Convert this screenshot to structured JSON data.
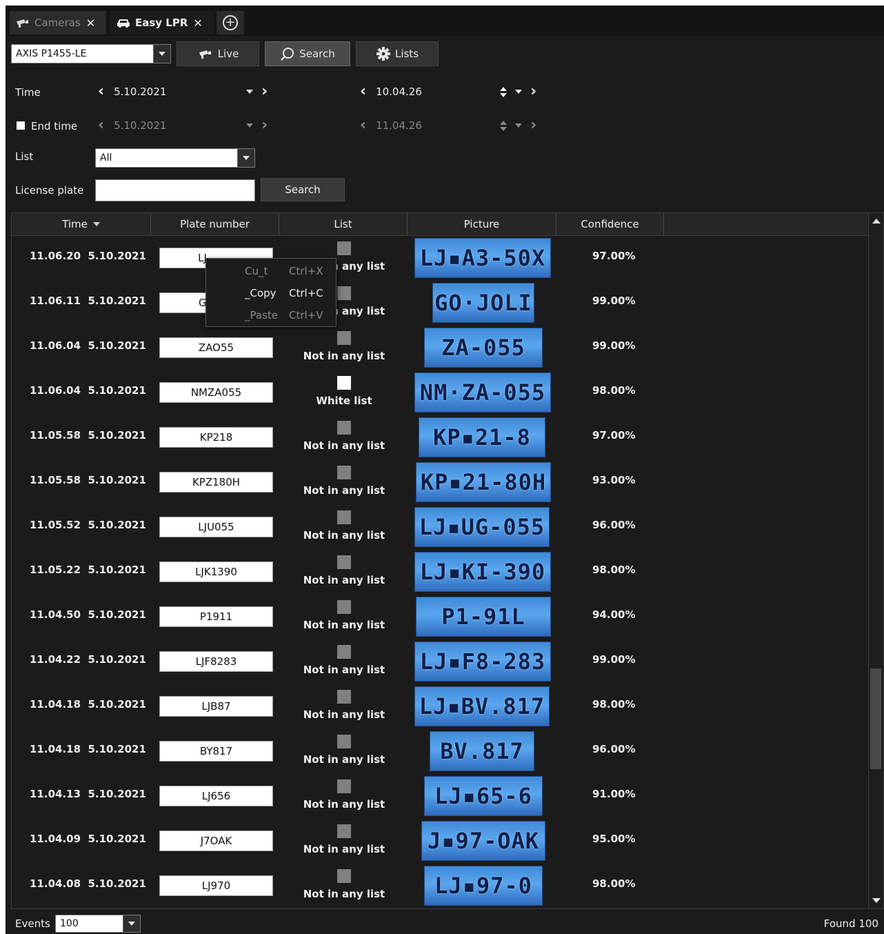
{
  "tabs": [
    {
      "label": "Cameras",
      "close": "✕"
    },
    {
      "label": "Easy LPR",
      "close": "✕"
    }
  ],
  "add_tab_symbol": "+",
  "toolbar": {
    "camera_select": "AXIS P1455-LE",
    "live_label": "Live",
    "search_label": "Search",
    "lists_label": "Lists"
  },
  "filters": {
    "time_label": "Time",
    "time_date": "5.10.2021",
    "time_clock": "10.04.26",
    "end_time_label": "End time",
    "end_date": "5.10.2021",
    "end_clock": "11.04.26",
    "list_label": "List",
    "list_value": "All",
    "plate_label": "License plate",
    "plate_value": "",
    "search_button": "Search"
  },
  "table": {
    "headers": [
      "Time",
      "Plate number",
      "List",
      "Picture",
      "Confidence"
    ],
    "rows": [
      {
        "time": "11.06.20  5.10.2021",
        "plate": "LJ",
        "list": "Not in any list",
        "list_color": "#808080",
        "picture_text": "LJ▪A3-50X",
        "confidence": "97.00%"
      },
      {
        "time": "11.06.11  5.10.2021",
        "plate": "G",
        "list": "Not in any list",
        "list_color": "#808080",
        "picture_text": "GO·JOLI",
        "confidence": "99.00%"
      },
      {
        "time": "11.06.04  5.10.2021",
        "plate": "ZAO55",
        "list": "Not in any list",
        "list_color": "#808080",
        "picture_text": "ZA-055",
        "confidence": "99.00%"
      },
      {
        "time": "11.06.04  5.10.2021",
        "plate": "NMZA055",
        "list": "White list",
        "list_color": "#ffffff",
        "picture_text": "NM·ZA-055",
        "confidence": "98.00%"
      },
      {
        "time": "11.05.58  5.10.2021",
        "plate": "KP218",
        "list": "Not in any list",
        "list_color": "#808080",
        "picture_text": "KP▪21-8",
        "confidence": "97.00%"
      },
      {
        "time": "11.05.58  5.10.2021",
        "plate": "KPZ180H",
        "list": "Not in any list",
        "list_color": "#808080",
        "picture_text": "KP▪21-80H",
        "confidence": "93.00%"
      },
      {
        "time": "11.05.52  5.10.2021",
        "plate": "LJU055",
        "list": "Not in any list",
        "list_color": "#808080",
        "picture_text": "LJ▪UG-055",
        "confidence": "96.00%"
      },
      {
        "time": "11.05.22  5.10.2021",
        "plate": "LJK1390",
        "list": "Not in any list",
        "list_color": "#808080",
        "picture_text": "LJ▪KI-390",
        "confidence": "98.00%"
      },
      {
        "time": "11.04.50  5.10.2021",
        "plate": "P1911",
        "list": "Not in any list",
        "list_color": "#808080",
        "picture_text": "P1-91L",
        "confidence": "94.00%"
      },
      {
        "time": "11.04.22  5.10.2021",
        "plate": "LJF8283",
        "list": "Not in any list",
        "list_color": "#808080",
        "picture_text": "LJ▪F8-283",
        "confidence": "99.00%"
      },
      {
        "time": "11.04.18  5.10.2021",
        "plate": "LJB87",
        "list": "Not in any list",
        "list_color": "#808080",
        "picture_text": "LJ▪BV.817",
        "confidence": "98.00%"
      },
      {
        "time": "11.04.18  5.10.2021",
        "plate": "BY817",
        "list": "Not in any list",
        "list_color": "#808080",
        "picture_text": "BV.817",
        "confidence": "96.00%"
      },
      {
        "time": "11.04.13  5.10.2021",
        "plate": "LJ656",
        "list": "Not in any list",
        "list_color": "#808080",
        "picture_text": "LJ▪65-6",
        "confidence": "91.00%"
      },
      {
        "time": "11.04.09  5.10.2021",
        "plate": "J7OAK",
        "list": "Not in any list",
        "list_color": "#808080",
        "picture_text": "J▪97-OAK",
        "confidence": "95.00%"
      },
      {
        "time": "11.04.08  5.10.2021",
        "plate": "LJ970",
        "list": "Not in any list",
        "list_color": "#808080",
        "picture_text": "LJ▪97-0",
        "confidence": "98.00%"
      }
    ]
  },
  "context_menu": [
    {
      "label": "Cu_t",
      "shortcut": "Ctrl+X",
      "enabled": false
    },
    {
      "label": "_Copy",
      "shortcut": "Ctrl+C",
      "enabled": true
    },
    {
      "label": "_Paste",
      "shortcut": "Ctrl+V",
      "enabled": false
    }
  ],
  "footer": {
    "events_label": "Events",
    "events_value": "100",
    "found": "Found 100"
  },
  "colors": {
    "background": "#1b1b1b",
    "plate_picture": "#3f8ad8"
  }
}
